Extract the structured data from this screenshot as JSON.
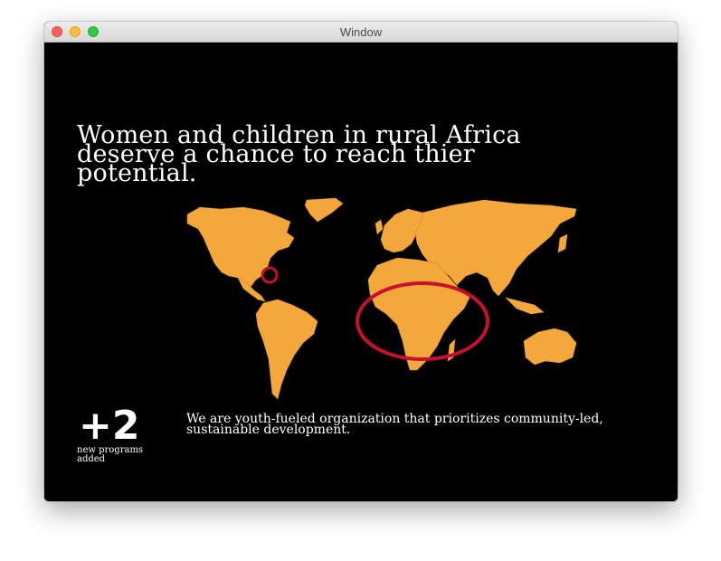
{
  "window": {
    "title": "Window",
    "controls": [
      "close",
      "minimize",
      "maximize"
    ]
  },
  "hero": {
    "headline": "Women and children in rural Africa deserve a chance to reach thier potential."
  },
  "map": {
    "icon": "world-map",
    "land_color": "#f4a73a",
    "highlight_color": "#c8102e",
    "highlights": [
      "north-america-east-coast",
      "africa"
    ]
  },
  "stat": {
    "number": "+2",
    "label": "new programs added"
  },
  "mission": {
    "text": "We are youth-fueled organization that prioritizes community-led, sustainable development."
  },
  "colors": {
    "background": "#000000",
    "text": "#ffffff",
    "accent": "#f4a73a",
    "highlight": "#c8102e"
  }
}
